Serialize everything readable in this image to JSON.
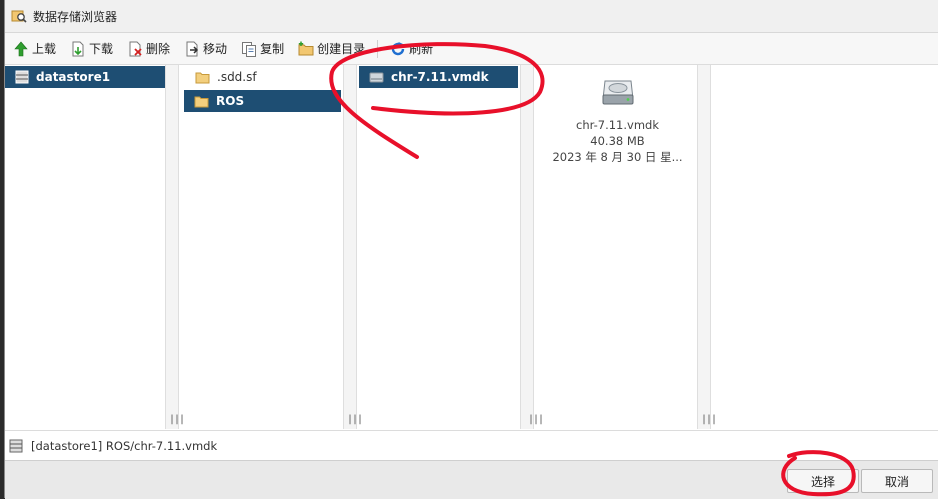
{
  "window": {
    "title": "数据存储浏览器"
  },
  "toolbar": {
    "upload": "上载",
    "download": "下载",
    "delete": "删除",
    "move": "移动",
    "copy": "复制",
    "create_dir": "创建目录",
    "refresh": "刷新"
  },
  "columns": {
    "datastores": [
      "datastore1"
    ],
    "folders": [
      ".sdd.sf",
      "ROS"
    ],
    "files": [
      "chr-7.11.vmdk"
    ]
  },
  "preview": {
    "name": "chr-7.11.vmdk",
    "size": "40.38 MB",
    "date": "2023 年 8 月 30 日 星..."
  },
  "path": "[datastore1] ROS/chr-7.11.vmdk",
  "buttons": {
    "select": "选择",
    "cancel": "取消"
  },
  "colors": {
    "selection": "#1e4e73",
    "annotation": "#e8102a"
  }
}
